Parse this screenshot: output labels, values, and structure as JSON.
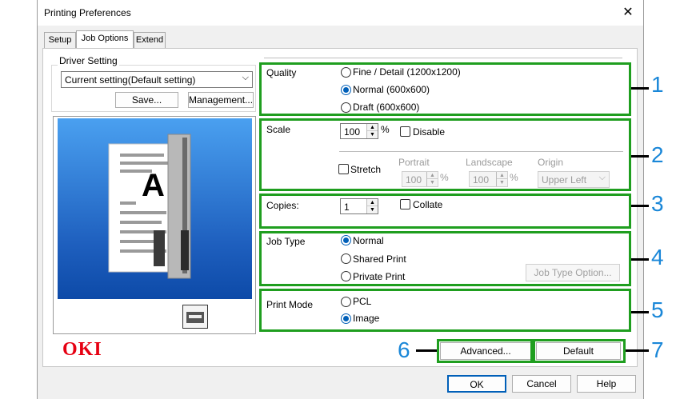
{
  "window": {
    "title": "Printing Preferences",
    "close_glyph": "✕"
  },
  "tabs": [
    {
      "label": "Setup"
    },
    {
      "label": "Job Options"
    },
    {
      "label": "Extend"
    }
  ],
  "driver_setting": {
    "group_label": "Driver Setting",
    "dropdown_value": "Current setting(Default setting)",
    "save_button": "Save...",
    "management_button": "Management..."
  },
  "quality": {
    "label": "Quality",
    "options": [
      {
        "label": "Fine / Detail (1200x1200)",
        "checked": false
      },
      {
        "label": "Normal (600x600)",
        "checked": true
      },
      {
        "label": "Draft (600x600)",
        "checked": false
      }
    ]
  },
  "scale": {
    "label": "Scale",
    "value": "100",
    "unit": "%",
    "disable_label": "Disable",
    "stretch_label": "Stretch",
    "portrait_label": "Portrait",
    "portrait_value": "100",
    "landscape_label": "Landscape",
    "landscape_value": "100",
    "origin_label": "Origin",
    "origin_value": "Upper Left"
  },
  "copies": {
    "label": "Copies:",
    "value": "1",
    "collate_label": "Collate"
  },
  "job_type": {
    "label": "Job Type",
    "options": [
      {
        "label": "Normal",
        "checked": true
      },
      {
        "label": "Shared Print",
        "checked": false
      },
      {
        "label": "Private Print",
        "checked": false
      }
    ],
    "option_button": "Job Type Option..."
  },
  "print_mode": {
    "label": "Print Mode",
    "options": [
      {
        "label": "PCL",
        "checked": false
      },
      {
        "label": "Image",
        "checked": true
      }
    ]
  },
  "preview": {
    "page_letter": "A"
  },
  "brand": {
    "logo": "OKI",
    "color": "#e60012"
  },
  "buttons": {
    "advanced": "Advanced...",
    "default": "Default",
    "ok": "OK",
    "cancel": "Cancel",
    "help": "Help"
  },
  "callouts": [
    "1",
    "2",
    "3",
    "4",
    "5",
    "6",
    "7"
  ],
  "colors": {
    "accent": "#005fb8",
    "highlight_box": "#1f9e1f",
    "callout_number": "#1a87d8",
    "preview_bg": "#1e5fbe"
  }
}
